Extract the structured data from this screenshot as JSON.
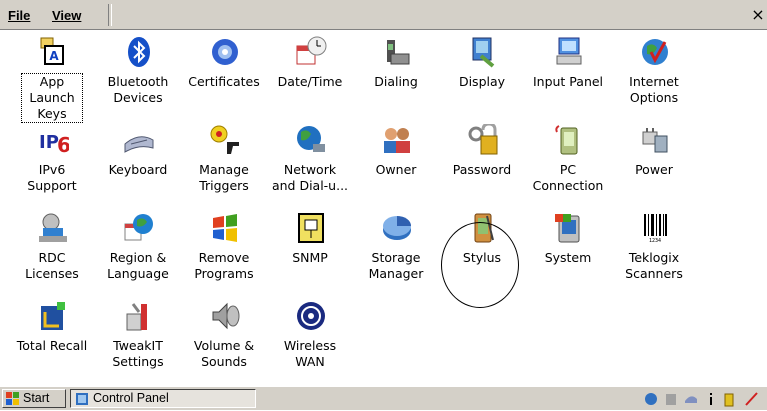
{
  "menubar": {
    "file": "File",
    "view": "View",
    "close": "×"
  },
  "items": [
    {
      "label": "App Launch\nKeys",
      "icon": "app-launch-keys-icon"
    },
    {
      "label": "Bluetooth\nDevices",
      "icon": "bluetooth-icon"
    },
    {
      "label": "Certificates",
      "icon": "certificates-icon"
    },
    {
      "label": "Date/Time",
      "icon": "date-time-icon"
    },
    {
      "label": "Dialing",
      "icon": "dialing-icon"
    },
    {
      "label": "Display",
      "icon": "display-icon"
    },
    {
      "label": "Input Panel",
      "icon": "input-panel-icon"
    },
    {
      "label": "Internet\nOptions",
      "icon": "internet-options-icon"
    },
    {
      "label": "IPv6\nSupport",
      "icon": "ipv6-icon"
    },
    {
      "label": "Keyboard",
      "icon": "keyboard-icon"
    },
    {
      "label": "Manage\nTriggers",
      "icon": "manage-triggers-icon"
    },
    {
      "label": "Network\nand Dial-u...",
      "icon": "network-icon"
    },
    {
      "label": "Owner",
      "icon": "owner-icon"
    },
    {
      "label": "Password",
      "icon": "password-icon"
    },
    {
      "label": "PC\nConnection",
      "icon": "pc-connection-icon"
    },
    {
      "label": "Power",
      "icon": "power-icon"
    },
    {
      "label": "RDC\nLicenses",
      "icon": "rdc-licenses-icon"
    },
    {
      "label": "Region &\nLanguage",
      "icon": "region-language-icon"
    },
    {
      "label": "Remove\nPrograms",
      "icon": "remove-programs-icon"
    },
    {
      "label": "SNMP",
      "icon": "snmp-icon"
    },
    {
      "label": "Storage\nManager",
      "icon": "storage-manager-icon"
    },
    {
      "label": "Stylus",
      "icon": "stylus-icon"
    },
    {
      "label": "System",
      "icon": "system-icon"
    },
    {
      "label": "Teklogix\nScanners",
      "icon": "barcode-scanner-icon"
    },
    {
      "label": "Total Recall",
      "icon": "total-recall-icon"
    },
    {
      "label": "TweakIT\nSettings",
      "icon": "tweakit-icon"
    },
    {
      "label": "Volume &\nSounds",
      "icon": "volume-sounds-icon"
    },
    {
      "label": "Wireless\nWAN",
      "icon": "wireless-wan-icon"
    }
  ],
  "taskbar": {
    "start": "Start",
    "task": "Control Panel"
  },
  "colors": {
    "chrome": "#d4d0c8",
    "background": "#ffffff",
    "highlight_circle": "#000000"
  }
}
